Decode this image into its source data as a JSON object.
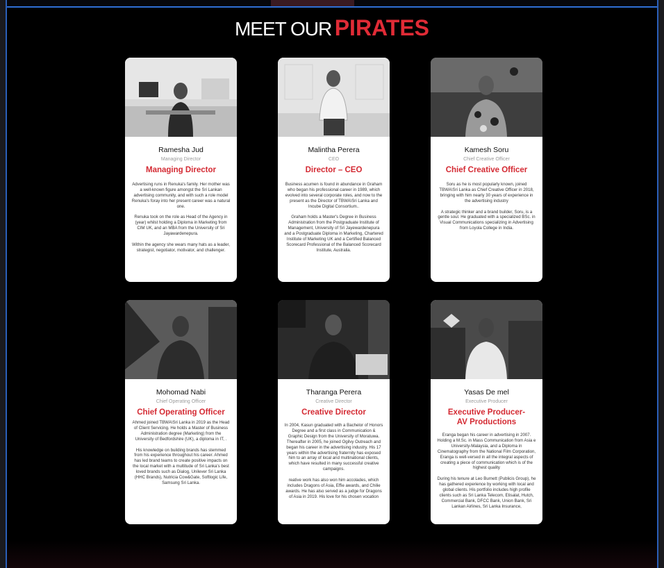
{
  "heading": {
    "prefix": "MEET OUR",
    "highlight": "PIRATES"
  },
  "colors": {
    "accent": "#e02b36",
    "frame_border": "#2b5fb8",
    "background": "#000000"
  },
  "people": [
    {
      "name": "Ramesha Jud",
      "subtitle": "Managing Director",
      "role": "Managing Director",
      "bio": "Advertising runs in Renuka's family. Her mother was a well-known figure amongst the Sri Lankan advertising community, and with such a role model Renuka's foray into her present career was a natural one.\n\nRenuka took on the role as Head of the Agency in (year) whilst holding a Diploma in Marketing from CIM UK, and an MBA from the University of Sri Jayawardenepura.\n\nWithin the agency she wears many hats as a leader, strategist, negotiator, motivator, and challenger."
    },
    {
      "name": "Malintha Perera",
      "subtitle": "CEO",
      "role": "Director –  CEO",
      "bio": "Business acumen is found in abundance in Graham who began his professional career in 1989, which evolved into several corporate roles, and now to the present as the Director of TBWA\\Sri Lanka and Incube Digital Consortium..\n\nGraham holds a Master's Degree in Business Administration from the Postgraduate Institute of Management, University of Sri Jayewardenepura and a Postgraduate Diploma in Marketing, Chartered Institute of Marketing UK and a Certified Balanced Scorecard Professional of the Balanced Scorecard Institute, Australia."
    },
    {
      "name": "Kamesh Soru",
      "subtitle": "Chief Creative Officer",
      "role": "Chief Creative Officer",
      "bio": "Soru as he is most popularly known, joined TBWA\\Sri Lanka as Chief Creative Officer in 2018, bringing with him nearly 30 years of experience in the advertising industry\n\nA strategic thinker and a brand builder, Soru, is a gentle soul. He graduated with a specialized BSc. in Visual Communications specializing in Advertising from Loyola College in India."
    },
    {
      "name": "Mohomad Nabi",
      "subtitle": "Chief Operating Officer",
      "role": "Chief Operating Officer",
      "bio": "Ahmed joined TBWA\\Sri Lanka in 2019 as the Head of Client Servicing. He holds a Master of Business Administration degree (Marketing) from the University of Bedfordshire (UK), a diploma in IT, .\n\nHis knowledge on building brands has stemmed from his experience throughout his career. Ahmed has led brand teams to create positive impacts on the local market with a multitude of Sri Lanka's best loved brands such as Dialog, Unilever Sri Lanka (HHC Brands), Nutricia Cow&Gate, Softlogic Life, Samsung Sri Lanka."
    },
    {
      "name": "Tharanga Perera",
      "subtitle": "Creative Director",
      "role": "Creative Director",
      "bio": "In 2004, Kasun graduated with a Bachelor of Honors Degree and a first class in Communication & Graphic Design from the University of Moratuwa. Thereafter in 2005, he joined Ogilvy Outreach and began his career in the advertising industry. His 17 years within the advertising fraternity has exposed him to an array of local and multinational clients, which have resulted in many successful creative campaigns.\n\nreative work has also won him accolades, which includes Dragons of Asia, Effie awards, and Chilie awards. He has also served as a judge for Dragons of Asia in 2019. His love for his chosen vocation"
    },
    {
      "name": "Yasas De mel",
      "subtitle": "Executive Producer",
      "role": "Executive Producer- AV Productions",
      "bio": "Eranga began his career in advertising in 2007. Holding a M.Sc. in Mass Communication from Asia e University-Malaysia, and a Diploma in Cinematography from the National Film Corporation, Eranga is well-versed in all the integral aspects of creating a piece of communication which is of the highest quality\n\nDuring his tenure at Leo Burnett (Publicis Group), he has gathered experience by working with local and global clients. His portfolio includes high profile clients such as Sri Lanka Telecom, Etisalat, Hutch, Commercial Bank, DFCC Bank, Union Bank, Sri Lankan Airlines, Sri Lanka Insurance,"
    }
  ]
}
